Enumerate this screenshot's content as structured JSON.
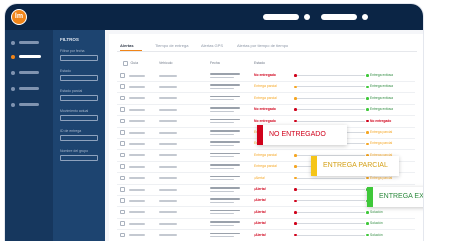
{
  "app": {
    "logo_text": "lm"
  },
  "filters": {
    "title": "FILTROS",
    "labels": [
      "Filtrar por fecha",
      "Estado",
      "Estado parcial",
      "Movimiento actual",
      "ID de entrega",
      "Nombre del grupo"
    ]
  },
  "tabs": [
    {
      "label": "Alertas",
      "active": true
    },
    {
      "label": "Tiempo de entrega",
      "active": false
    },
    {
      "label": "Alertas GPS",
      "active": false
    },
    {
      "label": "Alertas por tiempo de tiempo",
      "active": false
    }
  ],
  "table": {
    "headers": [
      "Guía",
      "Vehículo",
      "Fecha",
      "Estado"
    ],
    "rows": [
      {
        "status": "No entregado",
        "status_kind": "red",
        "result": "Entrega exitosa",
        "result_kind": "green"
      },
      {
        "status": "Entrega parcial",
        "status_kind": "orange",
        "result": "Entrega exitosa",
        "result_kind": "green"
      },
      {
        "status": "Entrega parcial",
        "status_kind": "orange",
        "result": "Entrega exitosa",
        "result_kind": "green"
      },
      {
        "status": "No entregado",
        "status_kind": "red",
        "result": "Entrega exitosa",
        "result_kind": "green"
      },
      {
        "status": "No entregado",
        "status_kind": "red",
        "result": "No entregado",
        "result_kind": "red"
      },
      {
        "status": "Entrega parcial",
        "status_kind": "orange",
        "result": "Entrega parcial",
        "result_kind": "orange"
      },
      {
        "status": "Entrega parcial",
        "status_kind": "orange",
        "result": "Entrega parcial",
        "result_kind": "orange"
      },
      {
        "status": "Entrega parcial",
        "status_kind": "orange",
        "result": "Entrega parcial",
        "result_kind": "orange"
      },
      {
        "status": "Entrega parcial",
        "status_kind": "orange",
        "result": "Entrega exitosa",
        "result_kind": "green"
      },
      {
        "status": "¡Alerta!",
        "status_kind": "orange",
        "result": "Entrega parcial",
        "result_kind": "orange"
      },
      {
        "status": "¡Alerta!",
        "status_kind": "alert",
        "result": "Solución",
        "result_kind": "green"
      },
      {
        "status": "¡Alerta!",
        "status_kind": "alert",
        "result": "Solución",
        "result_kind": "green"
      },
      {
        "status": "¡Alerta!",
        "status_kind": "alert",
        "result": "Solución",
        "result_kind": "green"
      },
      {
        "status": "¡Alerta!",
        "status_kind": "alert",
        "result": "Solución",
        "result_kind": "green"
      },
      {
        "status": "¡Alerta!",
        "status_kind": "alert",
        "result": "Solución",
        "result_kind": "green"
      }
    ]
  },
  "callouts": [
    {
      "label": "NO ENTREGADO",
      "color": "#d0021b"
    },
    {
      "label": "ENTREGA PARCIAL",
      "color": "#f5c518"
    },
    {
      "label": "ENTREGA EXITOSA",
      "color": "#3fc83a"
    }
  ],
  "colors": {
    "red": "#d0021b",
    "orange": "#f5a623",
    "green": "#3fc83a",
    "navy": "#0b2545",
    "accent": "#f08519"
  }
}
